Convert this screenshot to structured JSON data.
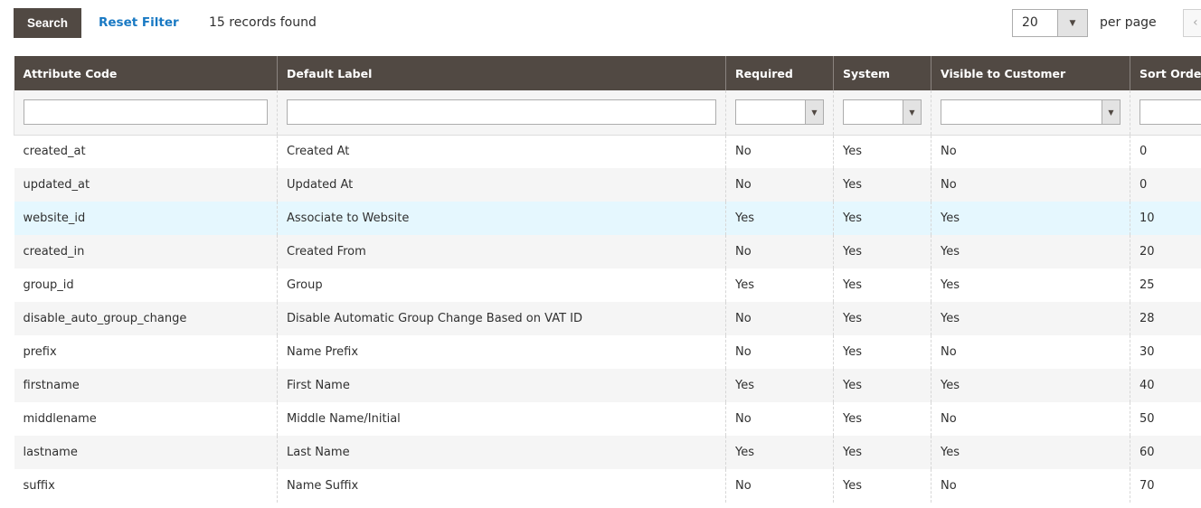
{
  "toolbar": {
    "search_label": "Search",
    "reset_label": "Reset Filter",
    "records": "15 records found",
    "per_page_value": "20",
    "per_page_label": "per page",
    "prev_glyph": "‹"
  },
  "columns": [
    "Attribute Code",
    "Default Label",
    "Required",
    "System",
    "Visible to Customer",
    "Sort Order"
  ],
  "rows": [
    [
      "created_at",
      "Created At",
      "No",
      "Yes",
      "No",
      "0"
    ],
    [
      "updated_at",
      "Updated At",
      "No",
      "Yes",
      "No",
      "0"
    ],
    [
      "website_id",
      "Associate to Website",
      "Yes",
      "Yes",
      "Yes",
      "10"
    ],
    [
      "created_in",
      "Created From",
      "No",
      "Yes",
      "Yes",
      "20"
    ],
    [
      "group_id",
      "Group",
      "Yes",
      "Yes",
      "Yes",
      "25"
    ],
    [
      "disable_auto_group_change",
      "Disable Automatic Group Change Based on VAT ID",
      "No",
      "Yes",
      "Yes",
      "28"
    ],
    [
      "prefix",
      "Name Prefix",
      "No",
      "Yes",
      "No",
      "30"
    ],
    [
      "firstname",
      "First Name",
      "Yes",
      "Yes",
      "Yes",
      "40"
    ],
    [
      "middlename",
      "Middle Name/Initial",
      "No",
      "Yes",
      "No",
      "50"
    ],
    [
      "lastname",
      "Last Name",
      "Yes",
      "Yes",
      "Yes",
      "60"
    ],
    [
      "suffix",
      "Name Suffix",
      "No",
      "Yes",
      "No",
      "70"
    ]
  ],
  "highlighted_row": 2,
  "colors": {
    "header_bg": "#514943",
    "link": "#1979c3",
    "highlight": "#e5f7fe"
  }
}
